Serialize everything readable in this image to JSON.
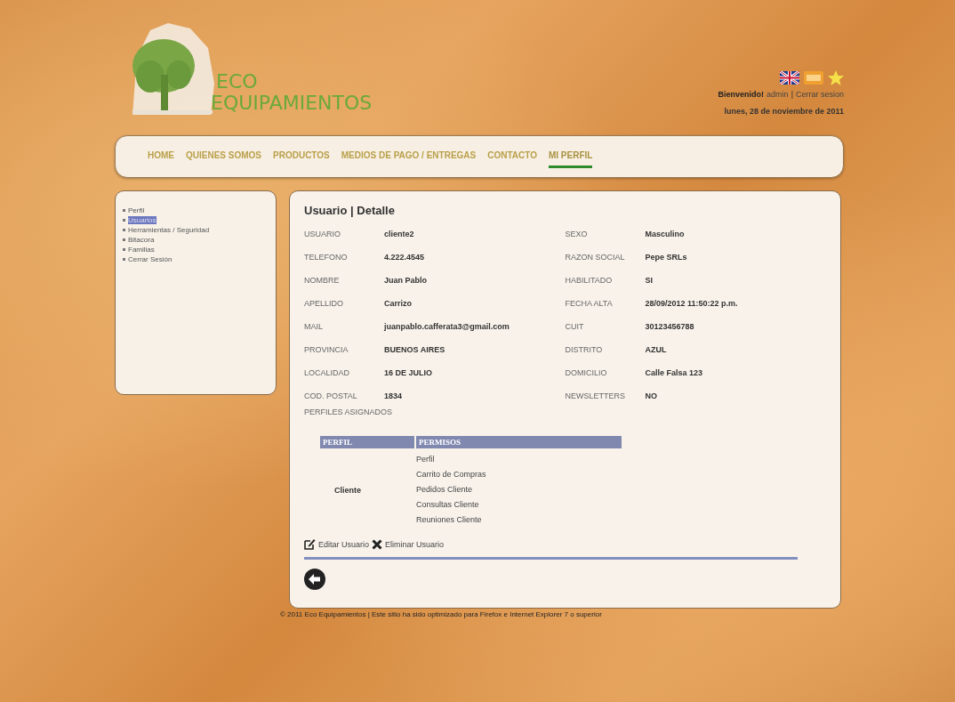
{
  "header": {
    "logo": {
      "line_1": "ECO",
      "line_2": "EQUIPAMIENTOS"
    },
    "welcome": {
      "greeting": "Bienvenido!",
      "user": "admin",
      "separator": "|",
      "logout": "Cerrar sesion"
    },
    "date": "lunes, 28 de noviembre de 2011"
  },
  "nav": [
    {
      "label": "HOME",
      "selected": false
    },
    {
      "label": "QUIENES SOMOS",
      "selected": false
    },
    {
      "label": "PRODUCTOS",
      "selected": false
    },
    {
      "label": "MEDIOS DE PAGO / ENTREGAS",
      "selected": false
    },
    {
      "label": "CONTACTO",
      "selected": false
    },
    {
      "label": "MI PERFIL",
      "selected": true
    }
  ],
  "sidebar": {
    "items": [
      {
        "label": "Perfil",
        "selected": false
      },
      {
        "label": "Usuarios",
        "selected": true
      },
      {
        "label": "Herramientas / Seguridad",
        "selected": false
      },
      {
        "label": "Bitacora",
        "selected": false
      },
      {
        "label": "Familias",
        "selected": false
      },
      {
        "label": "Cerrar Sesión",
        "selected": false
      }
    ]
  },
  "detail": {
    "title": "Usuario | Detalle",
    "left": [
      {
        "label": "USUARIO",
        "value": "cliente2"
      },
      {
        "label": "TELEFONO",
        "value": "4.222.4545"
      },
      {
        "label": "NOMBRE",
        "value": "Juan Pablo"
      },
      {
        "label": "APELLIDO",
        "value": "Carrizo"
      },
      {
        "label": "MAIL",
        "value": "juanpablo.cafferata3@gmail.com"
      },
      {
        "label": "PROVINCIA",
        "value": "BUENOS AIRES"
      },
      {
        "label": "LOCALIDAD",
        "value": "16 DE JULIO"
      },
      {
        "label": "COD. POSTAL",
        "value": "1834"
      }
    ],
    "right": [
      {
        "label": "SEXO",
        "value": "Masculino"
      },
      {
        "label": "RAZON SOCIAL",
        "value": "Pepe SRLs"
      },
      {
        "label": "HABILITADO",
        "value": "SI"
      },
      {
        "label": "FECHA ALTA",
        "value": "28/09/2012 11:50:22 p.m."
      },
      {
        "label": "CUIT",
        "value": "30123456788"
      },
      {
        "label": "DISTRITO",
        "value": "AZUL"
      },
      {
        "label": "DOMICILIO",
        "value": "Calle Falsa 123"
      },
      {
        "label": "NEWSLETTERS",
        "value": "NO"
      }
    ],
    "profiles_label": "PERFILES ASIGNADOS",
    "profiles_table": {
      "columns": [
        "PERFIL",
        "PERMISOS"
      ],
      "rows": [
        {
          "perfil": "Cliente",
          "permisos": [
            "Perfil",
            "Carrito de Compras",
            "Pedidos Cliente",
            "Consultas Cliente",
            "Reuniones Cliente"
          ]
        }
      ]
    },
    "actions": [
      "Editar Usuario",
      "Eliminar Usuario"
    ]
  },
  "footer": "© 2011 Eco Equipamientos | Este sitio ha sido optimizado para Firefox e Internet Explorer 7 o superior"
}
